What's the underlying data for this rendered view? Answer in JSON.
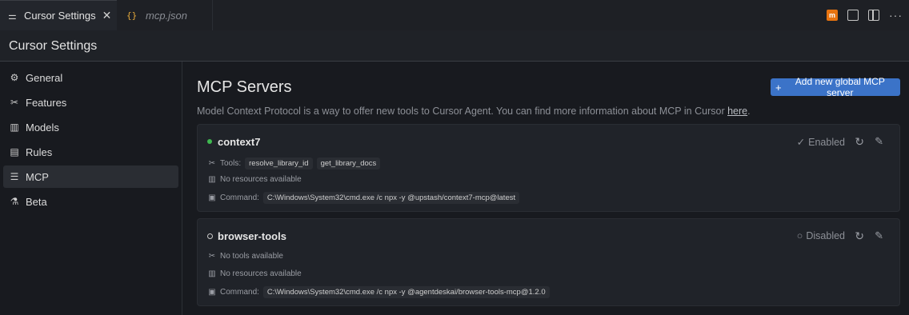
{
  "tabs": [
    {
      "icon": "sliders-icon",
      "label": "Cursor Settings",
      "close": "✕"
    },
    {
      "icon": "braces-icon",
      "label": "mcp.json"
    }
  ],
  "header": {
    "title": "Cursor Settings"
  },
  "sidebar": {
    "items": [
      {
        "label": "General",
        "icon": "gear-icon"
      },
      {
        "label": "Features",
        "icon": "tools-icon"
      },
      {
        "label": "Models",
        "icon": "bar-chart-icon"
      },
      {
        "label": "Rules",
        "icon": "document-icon"
      },
      {
        "label": "MCP",
        "icon": "server-icon",
        "selected": true
      },
      {
        "label": "Beta",
        "icon": "flask-icon"
      }
    ]
  },
  "main": {
    "title": "MCP Servers",
    "add_button": "Add new global MCP server",
    "description": "Model Context Protocol is a way to offer new tools to Cursor Agent. You can find more information about MCP in Cursor ",
    "description_link": "here",
    "description_end": ".",
    "servers": [
      {
        "name": "context7",
        "status": "Enabled",
        "status_color": "#3fb950",
        "tools_label": "Tools:",
        "tools": [
          "resolve_library_id",
          "get_library_docs"
        ],
        "resources": "No resources available",
        "command_label": "Command:",
        "command": "C:\\Windows\\System32\\cmd.exe /c npx -y @upstash/context7-mcp@latest"
      },
      {
        "name": "browser-tools",
        "status": "Disabled",
        "tools_text": "No tools available",
        "resources": "No resources available",
        "command_label": "Command:",
        "command": "C:\\Windows\\System32\\cmd.exe /c npx -y @agentdeskai/browser-tools-mcp@1.2.0"
      }
    ]
  },
  "colors": {
    "accent": "#3b73c8",
    "enabled": "#3fb950",
    "background": "#181a1f"
  }
}
